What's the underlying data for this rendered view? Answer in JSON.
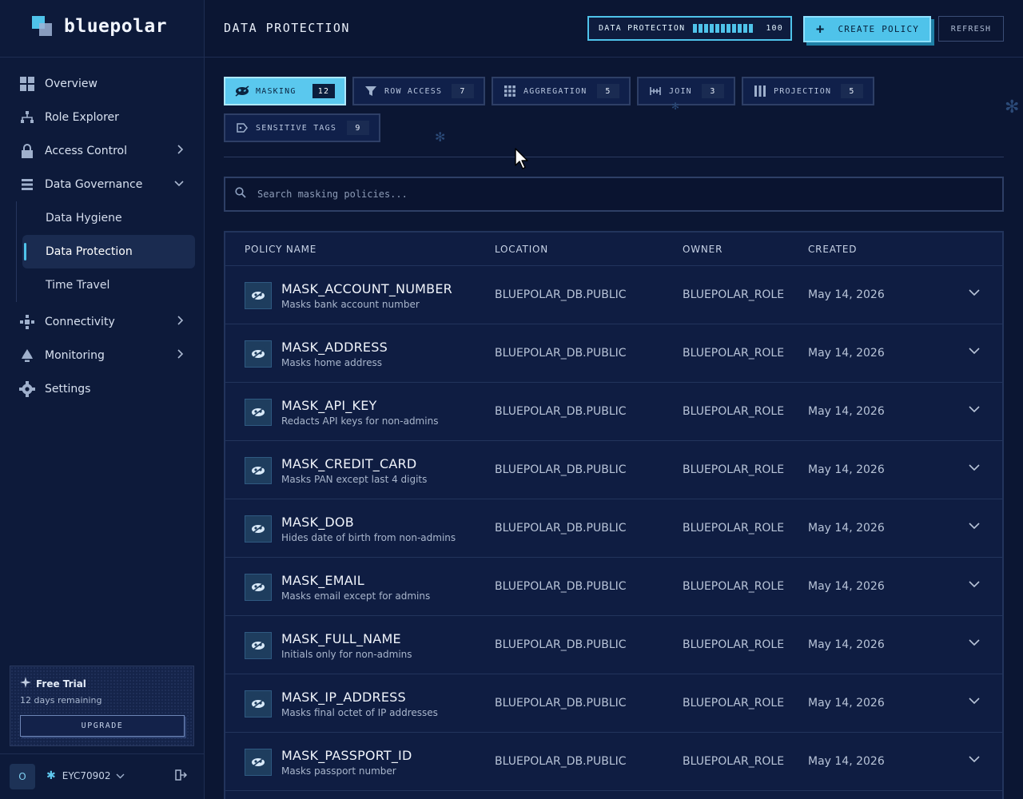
{
  "brand": {
    "name": "bluepolar"
  },
  "sidebar": {
    "items": [
      {
        "label": "Overview",
        "icon": "grid-icon",
        "chevron": ""
      },
      {
        "label": "Role Explorer",
        "icon": "hierarchy-icon",
        "chevron": ""
      },
      {
        "label": "Access Control",
        "icon": "lock-icon",
        "chevron": "›"
      },
      {
        "label": "Data Governance",
        "icon": "stack-icon",
        "chevron": "⌄"
      }
    ],
    "sub_items": [
      {
        "label": "Data Hygiene"
      },
      {
        "label": "Data Protection"
      },
      {
        "label": "Time Travel"
      }
    ],
    "items_after": [
      {
        "label": "Connectivity",
        "icon": "network-icon",
        "chevron": "›"
      },
      {
        "label": "Monitoring",
        "icon": "bell-icon",
        "chevron": "›"
      },
      {
        "label": "Settings",
        "icon": "gear-icon",
        "chevron": ""
      }
    ],
    "trial": {
      "title": "Free Trial",
      "subtitle": "12 days remaining",
      "upgrade_label": "UPGRADE"
    },
    "footer": {
      "avatar": "O",
      "org": "EYC70902"
    }
  },
  "header": {
    "title": "DATA PROTECTION",
    "meter": {
      "label": "DATA PROTECTION",
      "value": "100",
      "fraction": 1.0
    },
    "create_label": "CREATE POLICY",
    "refresh_label": "REFRESH"
  },
  "tabs": [
    {
      "label": "MASKING",
      "count": "12",
      "active": true
    },
    {
      "label": "ROW ACCESS",
      "count": "7"
    },
    {
      "label": "AGGREGATION",
      "count": "5"
    },
    {
      "label": "JOIN",
      "count": "3"
    },
    {
      "label": "PROJECTION",
      "count": "5"
    },
    {
      "label": "SENSITIVE TAGS",
      "count": "9"
    }
  ],
  "search": {
    "placeholder": "Search masking policies..."
  },
  "table": {
    "columns": [
      "POLICY NAME",
      "LOCATION",
      "OWNER",
      "CREATED"
    ],
    "rows": [
      {
        "name": "MASK_ACCOUNT_NUMBER",
        "desc": "Masks bank account number",
        "location": "BLUEPOLAR_DB.PUBLIC",
        "owner": "BLUEPOLAR_ROLE",
        "created": "May 14, 2026"
      },
      {
        "name": "MASK_ADDRESS",
        "desc": "Masks home address",
        "location": "BLUEPOLAR_DB.PUBLIC",
        "owner": "BLUEPOLAR_ROLE",
        "created": "May 14, 2026"
      },
      {
        "name": "MASK_API_KEY",
        "desc": "Redacts API keys for non-admins",
        "location": "BLUEPOLAR_DB.PUBLIC",
        "owner": "BLUEPOLAR_ROLE",
        "created": "May 14, 2026"
      },
      {
        "name": "MASK_CREDIT_CARD",
        "desc": "Masks PAN except last 4 digits",
        "location": "BLUEPOLAR_DB.PUBLIC",
        "owner": "BLUEPOLAR_ROLE",
        "created": "May 14, 2026"
      },
      {
        "name": "MASK_DOB",
        "desc": "Hides date of birth from non-admins",
        "location": "BLUEPOLAR_DB.PUBLIC",
        "owner": "BLUEPOLAR_ROLE",
        "created": "May 14, 2026"
      },
      {
        "name": "MASK_EMAIL",
        "desc": "Masks email except for admins",
        "location": "BLUEPOLAR_DB.PUBLIC",
        "owner": "BLUEPOLAR_ROLE",
        "created": "May 14, 2026"
      },
      {
        "name": "MASK_FULL_NAME",
        "desc": "Initials only for non-admins",
        "location": "BLUEPOLAR_DB.PUBLIC",
        "owner": "BLUEPOLAR_ROLE",
        "created": "May 14, 2026"
      },
      {
        "name": "MASK_IP_ADDRESS",
        "desc": "Masks final octet of IP addresses",
        "location": "BLUEPOLAR_DB.PUBLIC",
        "owner": "BLUEPOLAR_ROLE",
        "created": "May 14, 2026"
      },
      {
        "name": "MASK_PASSPORT_ID",
        "desc": "Masks passport number",
        "location": "BLUEPOLAR_DB.PUBLIC",
        "owner": "BLUEPOLAR_ROLE",
        "created": "May 14, 2026"
      }
    ]
  }
}
